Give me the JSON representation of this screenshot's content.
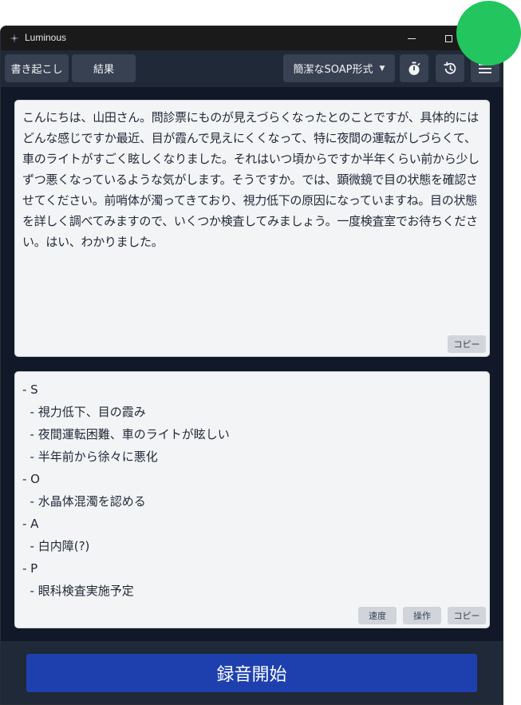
{
  "window": {
    "title": "Luminous"
  },
  "toolbar": {
    "transcribe_label": "書き起こし",
    "result_label": "結果",
    "format_label": "簡潔なSOAP形式",
    "icons": [
      "timer-icon",
      "history-icon",
      "menu-icon"
    ]
  },
  "transcript": {
    "text": "こんにちは、山田さん。問診票にものが見えづらくなったとのことですが、具体的にはどんな感じですか最近、目が霞んで見えにくくなって、特に夜間の運転がしづらくて、車のライトがすごく眩しくなりました。それはいつ頃からですか半年くらい前から少しずつ悪くなっているような気がします。そうですか。では、顕微鏡で目の状態を確認させてください。前哨体が濁ってきており、視力低下の原因になっていますね。目の状態を詳しく調べてみますので、いくつか検査してみましょう。一度検査室でお待ちください。はい、わかりました。",
    "copy_label": "コピー"
  },
  "result": {
    "lines": [
      "- S",
      "  - 視力低下、目の霞み",
      "  - 夜間運転困難、車のライトが眩しい",
      "  - 半年前から徐々に悪化",
      "- O",
      "  - 水晶体混濁を認める",
      "- A",
      "  - 白内障(?)",
      "- P",
      "  - 眼科検査実施予定"
    ],
    "speed_label": "速度",
    "ops_label": "操作",
    "copy_label": "コピー"
  },
  "footer": {
    "record_label": "録音開始"
  },
  "colors": {
    "background": "#111827",
    "toolbar": "#1f2937",
    "button": "#374151",
    "panel": "#f3f4f6",
    "record": "#1e40af",
    "indicator": "#22c55e"
  }
}
